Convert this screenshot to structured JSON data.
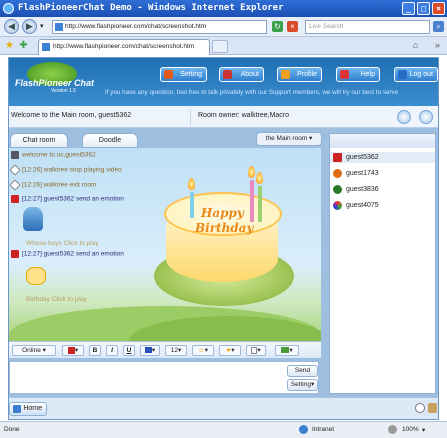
{
  "window": {
    "title": "FlashPioneerChat Demo - Windows Internet Explorer",
    "minimize": "_",
    "maximize": "□",
    "close": "×"
  },
  "browser": {
    "url": "http://www.flashpioneer.com/chat/screenshot.htm",
    "search_placeholder": "Live Search",
    "tab_title": "http://www.flashpioneer.com/chat/screenshot.htm"
  },
  "app": {
    "logo_text": "FlashPioneer Chat",
    "version": "Version 1.5",
    "top_buttons": [
      "Setting",
      "About",
      "Profile",
      "Help",
      "Log out"
    ],
    "info_text": "If you have any question, feel free to talk privately with our Support members, we will try our best to serve",
    "welcome": "Welcome to the Main room, guest5362",
    "room_owner": "Room owner: walktree,Macro",
    "tabs": [
      "Chat room",
      "Doodle"
    ],
    "room_select": "the Main room",
    "messages": [
      {
        "text": "welcome to us,guest5362",
        "kind": "system"
      },
      {
        "text": "[12:26] walktree stop playing video",
        "kind": "system"
      },
      {
        "text": "[12:26] walktree exit room",
        "kind": "system"
      },
      {
        "text": "[12:27] guest5362 send an emotion",
        "kind": "user"
      },
      {
        "text": "[12:27] guest5362 send an emotion",
        "kind": "user"
      }
    ],
    "emotion_captions": [
      "Whose boys Click to play",
      "Birthday  Click to play"
    ],
    "cake_text": [
      "Happy",
      "Birthday"
    ],
    "toolbar": {
      "status": "Online",
      "bold": "B",
      "italic": "I",
      "underline": "U",
      "font_size": "12"
    },
    "send_button": "Send",
    "setting_button": "Setting",
    "users": [
      "guest5362",
      "guest1743",
      "guest3836",
      "guest4075"
    ],
    "home_button": "Home"
  },
  "statusbar": {
    "done": "Done",
    "zone": "Intranet",
    "zoom": "100%"
  },
  "colors": {
    "header_blue": "#1f6fb3",
    "system_msg": "#8a6a2a",
    "user_msg": "#2b2b7a"
  }
}
